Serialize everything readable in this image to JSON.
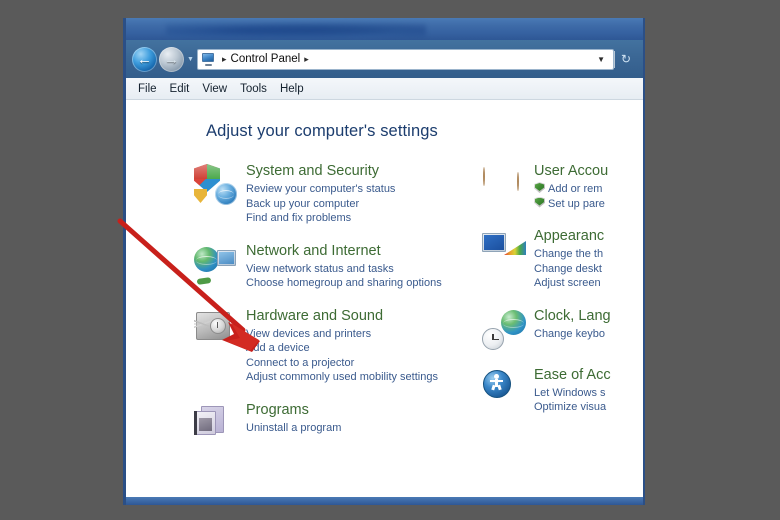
{
  "window": {
    "title_bar_visible": true,
    "address_bar": {
      "back_label": "Back",
      "forward_label": "Forward",
      "recent_pages_label": "Recent pages",
      "location_icon": "control-panel-icon",
      "crumb_separator": "▸",
      "breadcrumbs": [
        "Control Panel"
      ],
      "dropdown_icon": "▼",
      "refresh_icon": "↻"
    },
    "menubar": [
      "File",
      "Edit",
      "View",
      "Tools",
      "Help"
    ]
  },
  "content": {
    "heading": "Adjust your computer's settings",
    "left_column": [
      {
        "icon": "shield-globe-icon",
        "title": "System and Security",
        "links": [
          {
            "text": "Review your computer's status",
            "uac": false
          },
          {
            "text": "Back up your computer",
            "uac": false
          },
          {
            "text": "Find and fix problems",
            "uac": false
          }
        ]
      },
      {
        "icon": "network-globe-icon",
        "title": "Network and Internet",
        "links": [
          {
            "text": "View network status and tasks",
            "uac": false
          },
          {
            "text": "Choose homegroup and sharing options",
            "uac": false
          }
        ]
      },
      {
        "icon": "hardware-sound-icon",
        "title": "Hardware and Sound",
        "links": [
          {
            "text": "View devices and printers",
            "uac": false
          },
          {
            "text": "Add a device",
            "uac": false
          },
          {
            "text": "Connect to a projector",
            "uac": false
          },
          {
            "text": "Adjust commonly used mobility settings",
            "uac": false
          }
        ]
      },
      {
        "icon": "programs-icon",
        "title": "Programs",
        "links": [
          {
            "text": "Uninstall a program",
            "uac": false
          }
        ]
      }
    ],
    "right_column": [
      {
        "icon": "user-accounts-icon",
        "title": "User Accou",
        "links": [
          {
            "text": "Add or rem",
            "uac": true
          },
          {
            "text": "Set up pare",
            "uac": true
          }
        ]
      },
      {
        "icon": "appearance-icon",
        "title": "Appearanc",
        "links": [
          {
            "text": "Change the th",
            "uac": false
          },
          {
            "text": "Change deskt",
            "uac": false
          },
          {
            "text": "Adjust screen",
            "uac": false
          }
        ]
      },
      {
        "icon": "clock-language-icon",
        "title": "Clock, Lang",
        "links": [
          {
            "text": "Change keybo",
            "uac": false
          }
        ]
      },
      {
        "icon": "ease-of-access-icon",
        "title": "Ease of Acc",
        "links": [
          {
            "text": "Let Windows s",
            "uac": false
          },
          {
            "text": "Optimize visua",
            "uac": false
          }
        ]
      }
    ]
  },
  "annotation": {
    "arrow_color": "#c8201b",
    "arrow_name": "red-pointer-arrow",
    "points_to": "View devices and printers"
  },
  "colors": {
    "desktop_background": "#5a5a5a",
    "category_title": "#3d6b34",
    "link": "#3a5a8d",
    "page_heading": "#1c3d6e",
    "window_border": "#2b4f86"
  }
}
